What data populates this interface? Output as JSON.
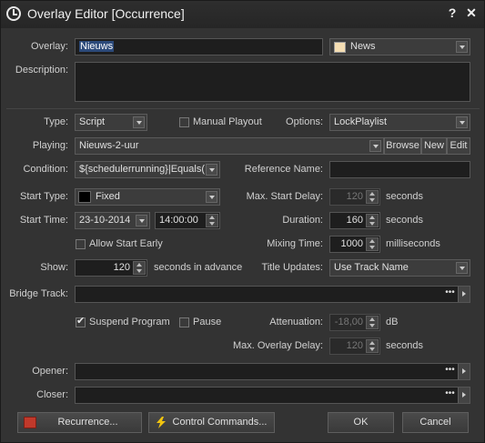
{
  "window": {
    "title": "Overlay Editor [Occurrence]",
    "help": "?",
    "close": "✕"
  },
  "overlay": {
    "label": "Overlay:",
    "value": "Nieuws",
    "category": "News",
    "swatch_color": "#f5deb3"
  },
  "description": {
    "label": "Description:",
    "value": ""
  },
  "type": {
    "label": "Type:",
    "value": "Script"
  },
  "manual_playout": {
    "label": "Manual Playout",
    "checked": false
  },
  "options": {
    "label": "Options:",
    "value": "LockPlaylist"
  },
  "playing": {
    "label": "Playing:",
    "value": "Nieuws-2-uur",
    "browse": "Browse",
    "new": "New",
    "edit": "Edit"
  },
  "condition": {
    "label": "Condition:",
    "value": "${schedulerrunning}|Equals("
  },
  "reference_name": {
    "label": "Reference Name:",
    "value": ""
  },
  "start_type": {
    "label": "Start Type:",
    "value": "Fixed"
  },
  "max_start_delay": {
    "label": "Max. Start Delay:",
    "value": "120",
    "unit": "seconds"
  },
  "start_time": {
    "label": "Start Time:",
    "date": "23-10-2014",
    "time": "14:00:00"
  },
  "duration": {
    "label": "Duration:",
    "value": "160",
    "unit": "seconds"
  },
  "allow_start_early": {
    "label": "Allow Start Early",
    "checked": false
  },
  "mixing_time": {
    "label": "Mixing Time:",
    "value": "1000",
    "unit": "milliseconds"
  },
  "show": {
    "label": "Show:",
    "value": "120",
    "unit": "seconds in advance"
  },
  "title_updates": {
    "label": "Title Updates:",
    "value": "Use Track Name"
  },
  "bridge_track": {
    "label": "Bridge Track:",
    "value": "",
    "dots": "•••"
  },
  "suspend_program": {
    "label": "Suspend Program",
    "checked": true
  },
  "pause": {
    "label": "Pause",
    "checked": false
  },
  "attenuation": {
    "label": "Attenuation:",
    "value": "-18,00",
    "unit": "dB"
  },
  "max_overlay_delay": {
    "label": "Max. Overlay Delay:",
    "value": "120",
    "unit": "seconds"
  },
  "opener": {
    "label": "Opener:",
    "value": "",
    "dots": "•••"
  },
  "closer": {
    "label": "Closer:",
    "value": "",
    "dots": "•••"
  },
  "buttons": {
    "recurrence": "Recurrence...",
    "control_commands": "Control Commands...",
    "ok": "OK",
    "cancel": "Cancel"
  }
}
